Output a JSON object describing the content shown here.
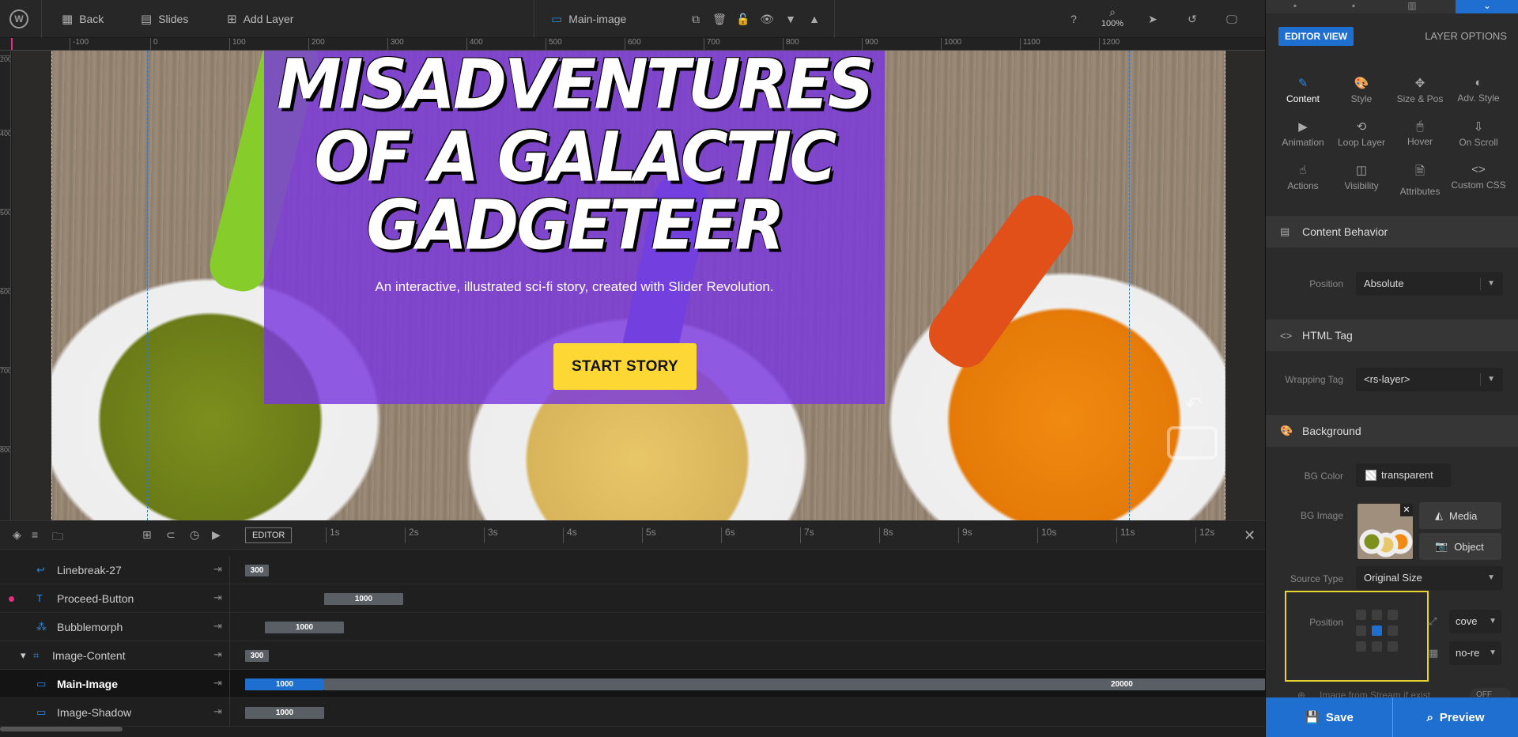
{
  "topbar": {
    "back_label": "Back",
    "slides_label": "Slides",
    "add_layer_label": "Add Layer",
    "layer_name": "Main-image",
    "zoom_level": "100%"
  },
  "ruler": {
    "h_ticks": [
      "-100",
      "0",
      "100",
      "200",
      "300",
      "400",
      "500",
      "600",
      "700",
      "800",
      "900",
      "1000",
      "1100",
      "1200"
    ],
    "v_ticks": [
      "200",
      "400",
      "500",
      "600",
      "700",
      "800"
    ]
  },
  "slide": {
    "headline_line1": "MISADVENTURES",
    "headline_line2": "OF A GALACTIC GADGETEER",
    "subtitle": "An interactive, illustrated sci-fi story, created with Slider Revolution.",
    "button_label": "START STORY"
  },
  "timeline": {
    "editor_label": "EDITOR",
    "time_ticks": [
      "1s",
      "2s",
      "3s",
      "4s",
      "5s",
      "6s",
      "7s",
      "8s",
      "9s",
      "10s",
      "11s",
      "12s"
    ],
    "rows": [
      {
        "name": "Linebreak-27",
        "bars": [
          "300"
        ]
      },
      {
        "name": "Proceed-Button",
        "bars": [
          "1000"
        ]
      },
      {
        "name": "Bubblemorph",
        "bars": [
          "1000"
        ]
      },
      {
        "name": "Image-Content",
        "bars": [
          "300"
        ]
      },
      {
        "name": "Main-Image",
        "bars": [
          "1000",
          "20000"
        ]
      },
      {
        "name": "Image-Shadow",
        "bars": [
          "1000"
        ]
      }
    ]
  },
  "panel": {
    "editor_view": "EDITOR VIEW",
    "layer_options": "LAYER OPTIONS",
    "categories": [
      {
        "label": "Content",
        "icon": "pencil-icon"
      },
      {
        "label": "Style",
        "icon": "palette-icon"
      },
      {
        "label": "Size & Pos",
        "icon": "move-icon"
      },
      {
        "label": "Adv. Style",
        "icon": "contrast-icon"
      },
      {
        "label": "Animation",
        "icon": "play-icon"
      },
      {
        "label": "Loop Layer",
        "icon": "loop-icon"
      },
      {
        "label": "Hover",
        "icon": "mouse-icon"
      },
      {
        "label": "On Scroll",
        "icon": "scroll-icon"
      },
      {
        "label": "Actions",
        "icon": "pointer-icon"
      },
      {
        "label": "Visibility",
        "icon": "eye-icon"
      },
      {
        "label": "Attributes",
        "icon": "document-icon"
      },
      {
        "label": "Custom CSS",
        "icon": "code-icon"
      }
    ],
    "content_behavior": {
      "title": "Content Behavior",
      "position_label": "Position",
      "position_value": "Absolute"
    },
    "html_tag": {
      "title": "HTML Tag",
      "wrapping_label": "Wrapping Tag",
      "wrapping_value": "<rs-layer>"
    },
    "background": {
      "title": "Background",
      "bg_color_label": "BG Color",
      "bg_color_value": "transparent",
      "bg_image_label": "BG Image",
      "media_label": "Media",
      "object_label": "Object",
      "source_type_label": "Source Type",
      "source_type_value": "Original Size",
      "position_label": "Position",
      "size_value": "cove",
      "repeat_value": "no-re",
      "stream_label": "Image from Stream if exist",
      "stream_toggle": "OFF"
    },
    "save_label": "Save",
    "preview_label": "Preview"
  },
  "colors": {
    "accent": "#1e6fd0",
    "overlay_purple": "#7a38de",
    "button_yellow": "#fdd835",
    "highlight_yellow": "#e6d431",
    "dot_pink": "#e32f7f"
  }
}
